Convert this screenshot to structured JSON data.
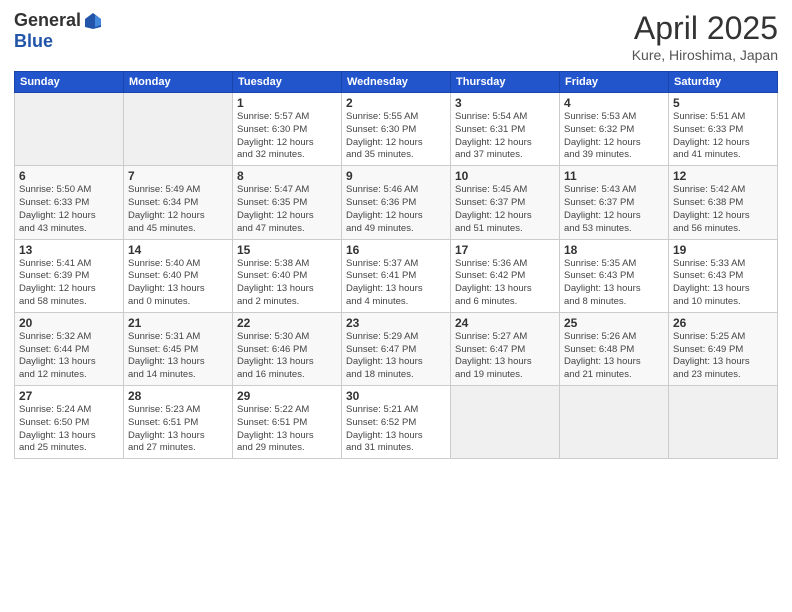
{
  "header": {
    "logo_general": "General",
    "logo_blue": "Blue",
    "title": "April 2025",
    "location": "Kure, Hiroshima, Japan"
  },
  "days_of_week": [
    "Sunday",
    "Monday",
    "Tuesday",
    "Wednesday",
    "Thursday",
    "Friday",
    "Saturday"
  ],
  "weeks": [
    [
      {
        "day": "",
        "info": ""
      },
      {
        "day": "",
        "info": ""
      },
      {
        "day": "1",
        "info": "Sunrise: 5:57 AM\nSunset: 6:30 PM\nDaylight: 12 hours\nand 32 minutes."
      },
      {
        "day": "2",
        "info": "Sunrise: 5:55 AM\nSunset: 6:30 PM\nDaylight: 12 hours\nand 35 minutes."
      },
      {
        "day": "3",
        "info": "Sunrise: 5:54 AM\nSunset: 6:31 PM\nDaylight: 12 hours\nand 37 minutes."
      },
      {
        "day": "4",
        "info": "Sunrise: 5:53 AM\nSunset: 6:32 PM\nDaylight: 12 hours\nand 39 minutes."
      },
      {
        "day": "5",
        "info": "Sunrise: 5:51 AM\nSunset: 6:33 PM\nDaylight: 12 hours\nand 41 minutes."
      }
    ],
    [
      {
        "day": "6",
        "info": "Sunrise: 5:50 AM\nSunset: 6:33 PM\nDaylight: 12 hours\nand 43 minutes."
      },
      {
        "day": "7",
        "info": "Sunrise: 5:49 AM\nSunset: 6:34 PM\nDaylight: 12 hours\nand 45 minutes."
      },
      {
        "day": "8",
        "info": "Sunrise: 5:47 AM\nSunset: 6:35 PM\nDaylight: 12 hours\nand 47 minutes."
      },
      {
        "day": "9",
        "info": "Sunrise: 5:46 AM\nSunset: 6:36 PM\nDaylight: 12 hours\nand 49 minutes."
      },
      {
        "day": "10",
        "info": "Sunrise: 5:45 AM\nSunset: 6:37 PM\nDaylight: 12 hours\nand 51 minutes."
      },
      {
        "day": "11",
        "info": "Sunrise: 5:43 AM\nSunset: 6:37 PM\nDaylight: 12 hours\nand 53 minutes."
      },
      {
        "day": "12",
        "info": "Sunrise: 5:42 AM\nSunset: 6:38 PM\nDaylight: 12 hours\nand 56 minutes."
      }
    ],
    [
      {
        "day": "13",
        "info": "Sunrise: 5:41 AM\nSunset: 6:39 PM\nDaylight: 12 hours\nand 58 minutes."
      },
      {
        "day": "14",
        "info": "Sunrise: 5:40 AM\nSunset: 6:40 PM\nDaylight: 13 hours\nand 0 minutes."
      },
      {
        "day": "15",
        "info": "Sunrise: 5:38 AM\nSunset: 6:40 PM\nDaylight: 13 hours\nand 2 minutes."
      },
      {
        "day": "16",
        "info": "Sunrise: 5:37 AM\nSunset: 6:41 PM\nDaylight: 13 hours\nand 4 minutes."
      },
      {
        "day": "17",
        "info": "Sunrise: 5:36 AM\nSunset: 6:42 PM\nDaylight: 13 hours\nand 6 minutes."
      },
      {
        "day": "18",
        "info": "Sunrise: 5:35 AM\nSunset: 6:43 PM\nDaylight: 13 hours\nand 8 minutes."
      },
      {
        "day": "19",
        "info": "Sunrise: 5:33 AM\nSunset: 6:43 PM\nDaylight: 13 hours\nand 10 minutes."
      }
    ],
    [
      {
        "day": "20",
        "info": "Sunrise: 5:32 AM\nSunset: 6:44 PM\nDaylight: 13 hours\nand 12 minutes."
      },
      {
        "day": "21",
        "info": "Sunrise: 5:31 AM\nSunset: 6:45 PM\nDaylight: 13 hours\nand 14 minutes."
      },
      {
        "day": "22",
        "info": "Sunrise: 5:30 AM\nSunset: 6:46 PM\nDaylight: 13 hours\nand 16 minutes."
      },
      {
        "day": "23",
        "info": "Sunrise: 5:29 AM\nSunset: 6:47 PM\nDaylight: 13 hours\nand 18 minutes."
      },
      {
        "day": "24",
        "info": "Sunrise: 5:27 AM\nSunset: 6:47 PM\nDaylight: 13 hours\nand 19 minutes."
      },
      {
        "day": "25",
        "info": "Sunrise: 5:26 AM\nSunset: 6:48 PM\nDaylight: 13 hours\nand 21 minutes."
      },
      {
        "day": "26",
        "info": "Sunrise: 5:25 AM\nSunset: 6:49 PM\nDaylight: 13 hours\nand 23 minutes."
      }
    ],
    [
      {
        "day": "27",
        "info": "Sunrise: 5:24 AM\nSunset: 6:50 PM\nDaylight: 13 hours\nand 25 minutes."
      },
      {
        "day": "28",
        "info": "Sunrise: 5:23 AM\nSunset: 6:51 PM\nDaylight: 13 hours\nand 27 minutes."
      },
      {
        "day": "29",
        "info": "Sunrise: 5:22 AM\nSunset: 6:51 PM\nDaylight: 13 hours\nand 29 minutes."
      },
      {
        "day": "30",
        "info": "Sunrise: 5:21 AM\nSunset: 6:52 PM\nDaylight: 13 hours\nand 31 minutes."
      },
      {
        "day": "",
        "info": ""
      },
      {
        "day": "",
        "info": ""
      },
      {
        "day": "",
        "info": ""
      }
    ]
  ]
}
